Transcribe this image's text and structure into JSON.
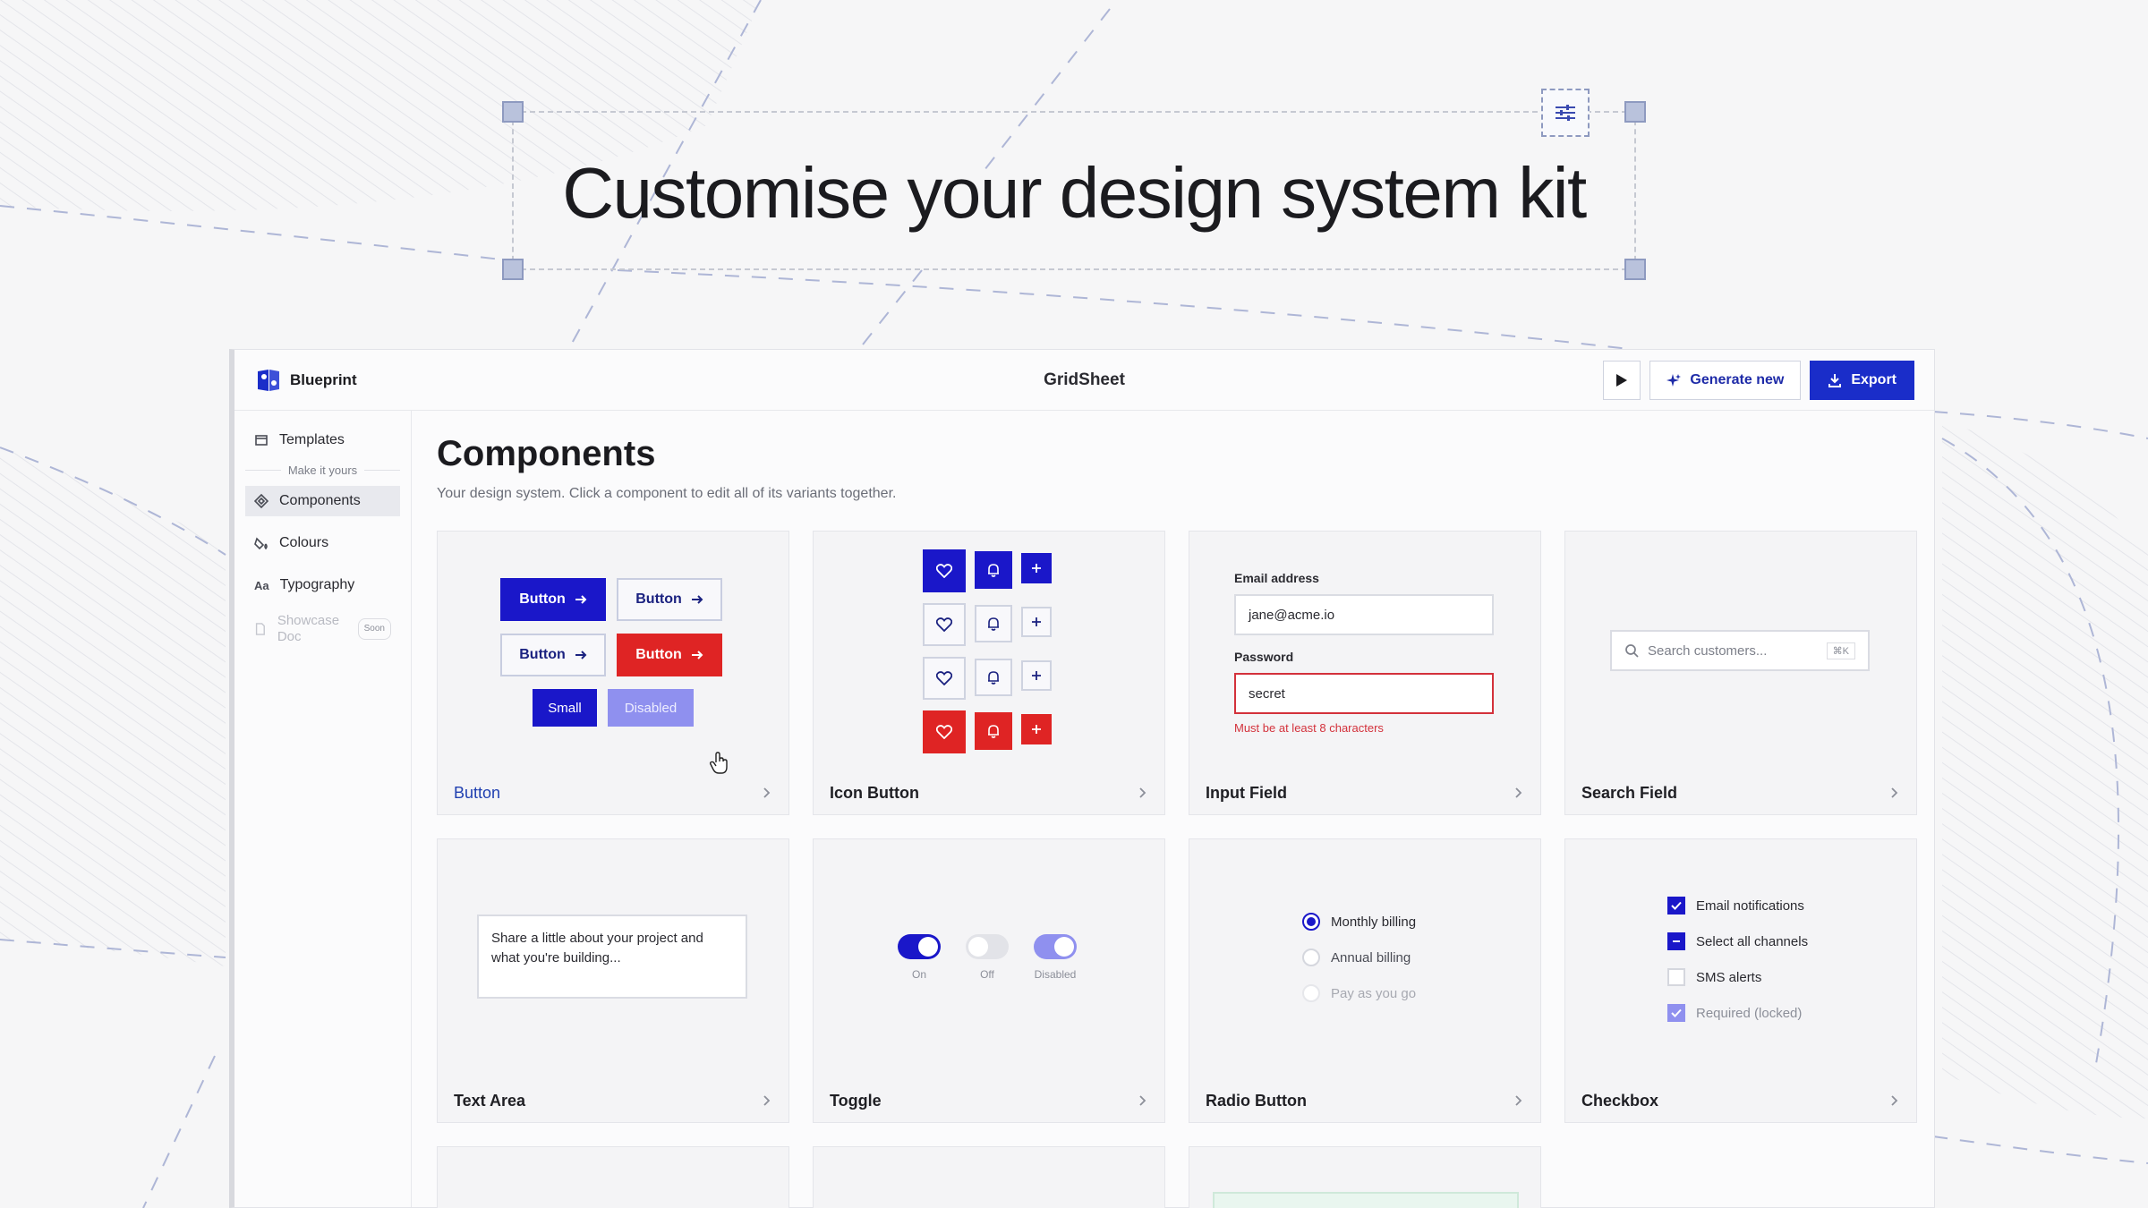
{
  "hero": {
    "title": "Customise your design system kit"
  },
  "app": {
    "brand_name": "Blueprint",
    "doc_title": "GridSheet",
    "actions": {
      "generate": "Generate new",
      "export": "Export"
    }
  },
  "sidebar": {
    "items": [
      {
        "label": "Templates",
        "icon": "templates-icon"
      },
      {
        "label": "Components",
        "icon": "components-icon"
      },
      {
        "label": "Colours",
        "icon": "colours-icon"
      },
      {
        "label": "Typography",
        "icon": "typography-icon"
      },
      {
        "label": "Showcase Doc",
        "icon": "doc-icon",
        "badge": "Soon"
      }
    ],
    "divider": "Make it yours"
  },
  "main": {
    "title": "Components",
    "subtitle": "Your design system. Click a component to edit all of its variants together."
  },
  "cards": {
    "button": {
      "label": "Button",
      "variants": [
        "Button",
        "Button",
        "Button",
        "Button"
      ],
      "small": "Small",
      "disabled": "Disabled"
    },
    "icon_button": {
      "label": "Icon Button"
    },
    "input_field": {
      "label": "Input Field",
      "email_label": "Email address",
      "email_value": "jane@acme.io",
      "password_label": "Password",
      "password_value": "secret",
      "error": "Must be at least 8 characters"
    },
    "search_field": {
      "label": "Search Field",
      "placeholder": "Search customers...",
      "shortcut": "⌘K"
    },
    "text_area": {
      "label": "Text Area",
      "value": "Share a little about your project and what you're building..."
    },
    "toggle": {
      "label": "Toggle",
      "on": "On",
      "off": "Off",
      "disabled": "Disabled"
    },
    "radio": {
      "label": "Radio Button",
      "options": [
        "Monthly billing",
        "Annual billing",
        "Pay as you go"
      ]
    },
    "checkbox": {
      "label": "Checkbox",
      "options": [
        "Email notifications",
        "Select all channels",
        "SMS alerts",
        "Required (locked)"
      ]
    }
  },
  "colors": {
    "accent": "#1a17c9",
    "danger": "#df2424",
    "disabled": "#8f90ef"
  }
}
